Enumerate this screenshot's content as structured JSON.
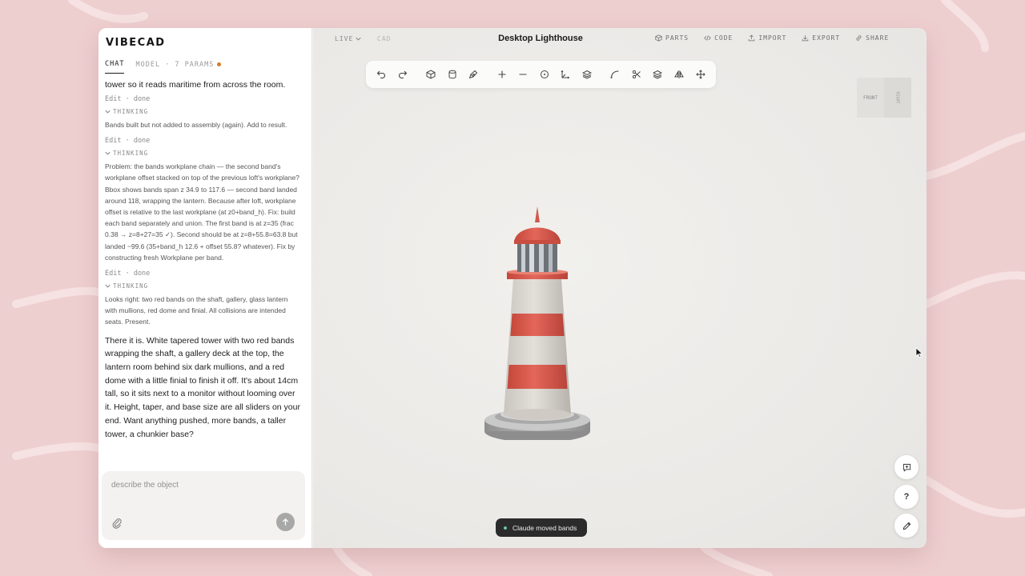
{
  "app": {
    "brand": "VIBECAD"
  },
  "left_panel": {
    "tabs": [
      {
        "label": "CHAT",
        "active": true
      },
      {
        "label": "MODEL · 7 PARAMS",
        "active": false
      }
    ],
    "messages": {
      "intro_tail": "tower so it reads maritime from across the room.",
      "status_1": "Edit · done",
      "thinking_label": "THINKING",
      "thinking_1": "Bands built but not added to assembly (again). Add to result.",
      "status_2": "Edit · done",
      "thinking_2": "Problem: the bands workplane chain — the second band's workplane offset stacked on top of the previous loft's workplane? Bbox shows bands span z 34.9 to 117.6 — second band landed around 118, wrapping the lantern. Because after loft, workplane offset is relative to the last workplane (at z0+band_h). Fix: build each band separately and union. The first band is at z=35 (frac 0.38 → z=8+27=35 ✓). Second should be at z=8+55.8=63.8 but landed ~99.6 (35+band_h 12.6 + offset 55.8? whatever). Fix by constructing fresh Workplane per band.",
      "status_3": "Edit · done",
      "thinking_3": "Looks right: two red bands on the shaft, gallery, glass lantern with mullions, red dome and finial. All collisions are intended seats. Present.",
      "final": "There it is. White tapered tower with two red bands wrapping the shaft, a gallery deck at the top, the lantern room behind six dark mullions, and a red dome with a little finial to finish it off. It's about 14cm tall, so it sits next to a monitor without looming over it. Height, taper, and base size are all sliders on your end. Want anything pushed, more bands, a taller tower, a chunkier base?"
    },
    "composer": {
      "placeholder": "describe the object"
    }
  },
  "viewport": {
    "mode_live": "LIVE",
    "mode_cad": "CAD",
    "title": "Desktop Lighthouse",
    "actions": [
      {
        "label": "PARTS",
        "icon": "cube-icon"
      },
      {
        "label": "CODE",
        "icon": "code-icon"
      },
      {
        "label": "IMPORT",
        "icon": "upload-icon"
      },
      {
        "label": "EXPORT",
        "icon": "download-icon"
      },
      {
        "label": "SHARE",
        "icon": "link-icon"
      }
    ],
    "toolbar_icons": [
      "undo-icon",
      "redo-icon",
      "box-icon",
      "cylinder-icon",
      "pen-icon",
      "plus-icon",
      "minus-icon",
      "circle-icon",
      "axis-icon",
      "layers-icon",
      "curve-icon",
      "scissors-icon",
      "stack-icon",
      "mirror-icon",
      "move-icon"
    ],
    "view_cube": {
      "front": "FRONT",
      "right": "RIGHT"
    },
    "toast": "Claude moved bands",
    "fabs": [
      "comment-add-icon",
      "help-icon",
      "edit-icon"
    ],
    "help_label": "?"
  },
  "colors": {
    "accent_red": "#dc5a4b",
    "tower_white": "#dbd7d0",
    "brand_dot": "#d77a2c",
    "page_bg": "#eecfd0"
  }
}
